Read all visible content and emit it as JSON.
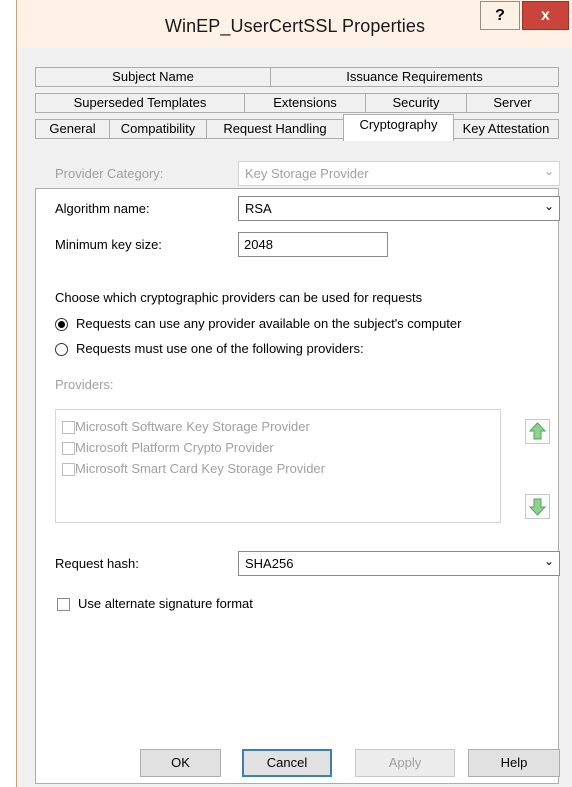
{
  "window": {
    "title": "WinEP_UserCertSSL Properties",
    "help_label": "?",
    "close_label": "x"
  },
  "tabs": {
    "row1": [
      "Subject Name",
      "Issuance Requirements"
    ],
    "row2": [
      "Superseded Templates",
      "Extensions",
      "Security",
      "Server"
    ],
    "row3": [
      "General",
      "Compatibility",
      "Request Handling",
      "Cryptography",
      "Key Attestation"
    ],
    "active": "Cryptography"
  },
  "crypto": {
    "provider_category_label": "Provider Category:",
    "provider_category_value": "Key Storage Provider",
    "algorithm_label": "Algorithm name:",
    "algorithm_value": "RSA",
    "min_key_label": "Minimum key size:",
    "min_key_value": "2048",
    "choose_text": "Choose which cryptographic providers can be used for requests",
    "radio_any": "Requests can use any provider available on the subject's computer",
    "radio_must": "Requests must use one of the following providers:",
    "radio_selected": "any",
    "providers_label": "Providers:",
    "providers": [
      "Microsoft Software Key Storage Provider",
      "Microsoft Platform Crypto Provider",
      "Microsoft Smart Card Key Storage Provider"
    ],
    "hash_label": "Request hash:",
    "hash_value": "SHA256",
    "alt_sig_label": "Use alternate signature format"
  },
  "buttons": {
    "ok": "OK",
    "cancel": "Cancel",
    "apply": "Apply",
    "help": "Help"
  },
  "colors": {
    "title_bg": "#fef2e6",
    "close_red": "#c9443a",
    "arrow_green": "#4caf50"
  }
}
